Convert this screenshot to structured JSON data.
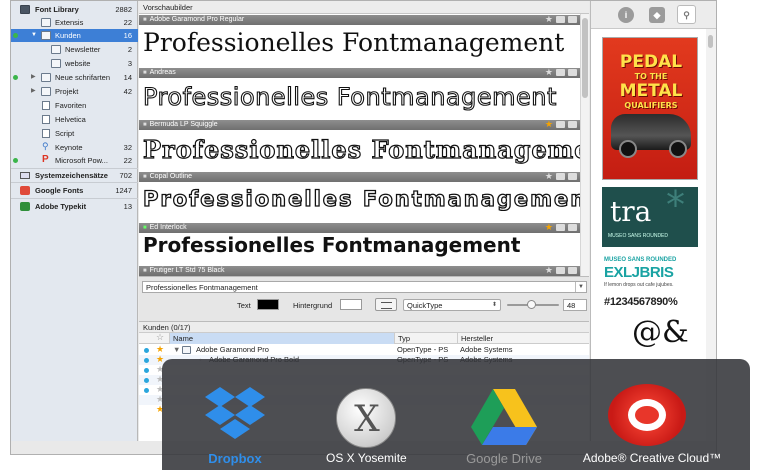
{
  "sidebar": {
    "items": [
      {
        "label": "Font Library",
        "count": "2882"
      },
      {
        "label": "Extensis",
        "count": "22"
      },
      {
        "label": "Kunden",
        "count": "16"
      },
      {
        "label": "Newsletter",
        "count": "2"
      },
      {
        "label": "website",
        "count": "3"
      },
      {
        "label": "Neue schrifarten",
        "count": "14"
      },
      {
        "label": "Projekt",
        "count": "42"
      },
      {
        "label": "Favoriten",
        "count": ""
      },
      {
        "label": "Helvetica",
        "count": ""
      },
      {
        "label": "Script",
        "count": ""
      },
      {
        "label": "Keynote",
        "count": "32"
      },
      {
        "label": "Microsoft Pow...",
        "count": "22"
      },
      {
        "label": "Systemzeichensätze",
        "count": "702"
      },
      {
        "label": "Google Fonts",
        "count": "1247"
      },
      {
        "label": "Adobe Typekit",
        "count": "13"
      }
    ]
  },
  "preview": {
    "header": "Vorschaubilder",
    "sample_text": "Professionelles Fontmanagement",
    "fonts": [
      {
        "name": "Adobe Garamond Pro Regular",
        "starred": false
      },
      {
        "name": "Andreas",
        "starred": false
      },
      {
        "name": "Bermuda LP Squiggle",
        "starred": true
      },
      {
        "name": "Copal Outline",
        "starred": false
      },
      {
        "name": "Ed Interlock",
        "starred": true
      },
      {
        "name": "Frutiger LT Std 75 Black",
        "starred": false
      }
    ]
  },
  "controls": {
    "sample_input": "Professionelles Fontmanagement",
    "text_label": "Text",
    "background_label": "Hintergrund",
    "mode": "QuickType",
    "size": "48",
    "text_color": "#000000",
    "background_color": "#ffffff"
  },
  "list": {
    "title": "Kunden (0/17)",
    "columns": {
      "name": "Name",
      "type": "Typ",
      "maker": "Hersteller"
    },
    "rows": [
      {
        "name": "Adobe Garamond Pro",
        "type": "OpenType - PS",
        "maker": "Adobe Systems"
      },
      {
        "name": "Adobe Garamond Pro Bold",
        "type": "OpenType - PS",
        "maker": "Adobe Systems"
      }
    ]
  },
  "right_panel": {
    "poster_lines": [
      "PEDAL",
      "TO THE",
      "METAL",
      "QUALIFIERS"
    ],
    "tra_text": "tra",
    "tra_caption": "MUSEO SANS ROUNDED",
    "museo_title": "MUSEO SANS ROUNDED",
    "museo_big": "EXLJBRIS",
    "museo_text": "If lemon drops out cafe jujubes.",
    "museo_numbers": "#1234567890%",
    "museo_glyph": "@&"
  },
  "services": [
    {
      "name": "Dropbox",
      "icon": "dropbox-icon"
    },
    {
      "name": "OS X Yosemite",
      "icon": "osx-icon"
    },
    {
      "name": "Google Drive",
      "icon": "google-drive-icon"
    },
    {
      "name": "Adobe® Creative Cloud™",
      "icon": "creative-cloud-icon"
    }
  ],
  "colors": {
    "selection": "#3d7fd6",
    "star": "#f5a300",
    "dropbox": "#2f8eea",
    "adobe_red": "#e8362a"
  }
}
